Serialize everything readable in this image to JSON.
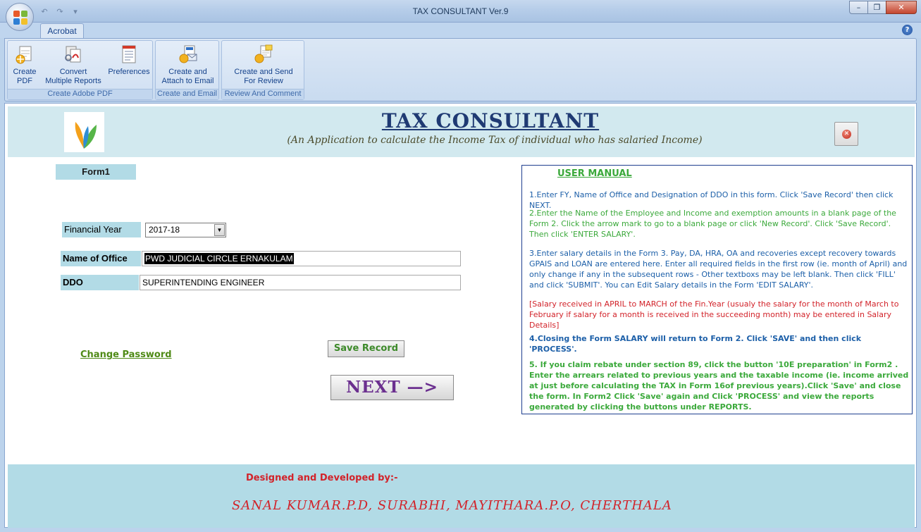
{
  "window": {
    "title": "TAX CONSULTANT Ver.9",
    "minimize": "–",
    "restore": "❐",
    "close": "✕"
  },
  "ribbon": {
    "tab": "Acrobat",
    "help": "?",
    "groups": [
      {
        "label": "Create Adobe PDF",
        "buttons": [
          {
            "line1": "Create",
            "line2": "PDF"
          },
          {
            "line1": "Convert",
            "line2": "Multiple Reports"
          },
          {
            "line1": "Preferences",
            "line2": ""
          }
        ]
      },
      {
        "label": "Create and Email",
        "buttons": [
          {
            "line1": "Create and",
            "line2": "Attach to Email"
          }
        ]
      },
      {
        "label": "Review And Comment",
        "buttons": [
          {
            "line1": "Create and Send",
            "line2": "For Review"
          }
        ]
      }
    ]
  },
  "header": {
    "title": "TAX CONSULTANT",
    "subtitle": "(An Application to calculate the Income Tax of individual who has salaried Income)"
  },
  "form": {
    "form_name": "Form1",
    "fy_label": "Financial Year",
    "fy_value": "2017-18",
    "office_label": "Name of Office",
    "office_value": "PWD JUDICIAL CIRCLE ERNAKULAM",
    "ddo_label": "DDO",
    "ddo_value": "SUPERINTENDING ENGINEER",
    "change_password": "Change Password",
    "save_record": "Save Record",
    "next": "NEXT —>"
  },
  "manual": {
    "title": "USER MANUAL",
    "p1": "1.Enter FY, Name of Office and Designation of DDO in this form. Click 'Save Record' then click NEXT.",
    "p2": "2.Enter the Name of the Employee and Income and exemption amounts in a blank page of the Form 2. Click the arrow mark to go to a blank page or click 'New Record'. Click 'Save Record'. Then click 'ENTER SALARY'.",
    "p3": "3.Enter salary details in the Form 3.  Pay, DA, HRA, OA and recoveries except recovery towards GPAIS and LOAN are entered here. Enter all required  fields in the first row (ie. month of April) and only change if any in the subsequent rows - Other textboxs may be left blank. Then  click 'FILL' and click 'SUBMIT'. You can Edit Salary details in the Form 'EDIT SALARY'.",
    "p3b": "[Salary received in APRIL to MARCH of the Fin.Year (usualy the salary for the month of March to February if salary for a month is received in the succeeding month) may be entered in Salary Details]",
    "p4": "4.Closing the Form SALARY  will return to Form 2.  Click 'SAVE' and then click 'PROCESS'.",
    "p5": "5. If you claim rebate under section 89, click the button '10E preparation' in Form2 . Enter the arrears related to previous years and the taxable income (ie. income arrived at just before calculating the TAX in Form 16of previous years).Click 'Save' and close the form.  In Form2 Click 'Save' again and Click 'PROCESS' and view the reports generated by clicking the buttons under REPORTS."
  },
  "footer": {
    "label": "Designed and Developed by:-",
    "name": "SANAL KUMAR.P.D, SURABHI, MAYITHARA.P.O, CHERTHALA"
  },
  "colors": {
    "title_blue": "#1f3a73",
    "manual_blue": "#1c5fa8",
    "manual_green": "#3ba93b",
    "manual_red": "#d2232a",
    "band": "#b2dbe6"
  }
}
